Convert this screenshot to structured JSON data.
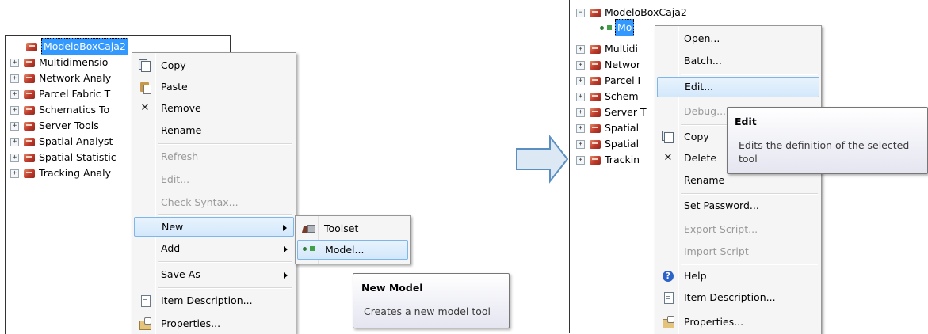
{
  "left": {
    "tree": [
      {
        "label": "ModeloBoxCaja2",
        "expander": "",
        "selected": true
      },
      {
        "label": "Multidimensio",
        "expander": "+"
      },
      {
        "label": "Network Analy",
        "expander": "+"
      },
      {
        "label": "Parcel Fabric T",
        "expander": "+"
      },
      {
        "label": "Schematics To",
        "expander": "+"
      },
      {
        "label": "Server Tools",
        "expander": "+"
      },
      {
        "label": "Spatial Analyst",
        "expander": "+"
      },
      {
        "label": "Spatial Statistic",
        "expander": "+"
      },
      {
        "label": "Tracking Analy",
        "expander": "+"
      }
    ],
    "context_menu": {
      "items": [
        {
          "label": "Copy",
          "icon": "copy-icon",
          "disabled": false
        },
        {
          "label": "Paste",
          "icon": "paste-icon",
          "disabled": false
        },
        {
          "label": "Remove",
          "icon": "close-icon",
          "disabled": false
        },
        {
          "label": "Rename",
          "icon": "",
          "disabled": false
        },
        {
          "label": "Refresh",
          "icon": "",
          "disabled": true
        },
        {
          "label": "Edit...",
          "icon": "",
          "disabled": true
        },
        {
          "label": "Check Syntax...",
          "icon": "",
          "disabled": true
        },
        {
          "label": "New",
          "icon": "",
          "disabled": false,
          "submenu": true,
          "highlighted": true
        },
        {
          "label": "Add",
          "icon": "",
          "disabled": false,
          "submenu": true
        },
        {
          "label": "Save As",
          "icon": "",
          "disabled": false,
          "submenu": true
        },
        {
          "label": "Item Description...",
          "icon": "item-description-icon",
          "disabled": false
        },
        {
          "label": "Properties...",
          "icon": "properties-icon",
          "disabled": false
        }
      ]
    },
    "submenu": {
      "items": [
        {
          "label": "Toolset",
          "icon": "toolset-icon"
        },
        {
          "label": "Model...",
          "icon": "model-icon",
          "highlighted": true
        }
      ]
    },
    "tooltip": {
      "title": "New Model",
      "description": "Creates a new model tool"
    }
  },
  "right": {
    "tree": [
      {
        "label": "ModeloBoxCaja2",
        "expander": "−"
      },
      {
        "label": "Mo",
        "selected": true,
        "child": true
      },
      {
        "label": "Multidi",
        "expander": "+"
      },
      {
        "label": "Networ",
        "expander": "+"
      },
      {
        "label": "Parcel I",
        "expander": "+"
      },
      {
        "label": "Schem",
        "expander": "+"
      },
      {
        "label": "Server T",
        "expander": "+"
      },
      {
        "label": "Spatial",
        "expander": "+"
      },
      {
        "label": "Spatial",
        "expander": "+"
      },
      {
        "label": "Trackin",
        "expander": "+"
      }
    ],
    "context_menu": {
      "items": [
        {
          "label": "Open...",
          "icon": "",
          "disabled": false
        },
        {
          "label": "Batch...",
          "icon": "",
          "disabled": false
        },
        {
          "label": "Edit...",
          "icon": "",
          "disabled": false,
          "highlighted": true
        },
        {
          "label": "Debug...",
          "icon": "",
          "disabled": true
        },
        {
          "label": "Copy",
          "icon": "copy-icon",
          "disabled": false
        },
        {
          "label": "Delete",
          "icon": "close-icon",
          "disabled": false
        },
        {
          "label": "Rename",
          "icon": "",
          "disabled": false
        },
        {
          "label": "Set Password...",
          "icon": "",
          "disabled": false
        },
        {
          "label": "Export Script...",
          "icon": "",
          "disabled": true
        },
        {
          "label": "Import Script",
          "icon": "",
          "disabled": true
        },
        {
          "label": "Help",
          "icon": "help-icon",
          "disabled": false
        },
        {
          "label": "Item Description...",
          "icon": "item-description-icon",
          "disabled": false
        },
        {
          "label": "Properties...",
          "icon": "properties-icon",
          "disabled": false
        }
      ]
    },
    "tooltip": {
      "title": "Edit",
      "description_line1": "Edits the definition of the selected",
      "description_line2": "tool"
    }
  },
  "colors": {
    "selection": "#3399ff",
    "menu_bg": "#f5f5f5",
    "hover_border": "#7fb6ea",
    "arrow_fill": "#dce9f5",
    "arrow_stroke": "#5b8fc2"
  }
}
